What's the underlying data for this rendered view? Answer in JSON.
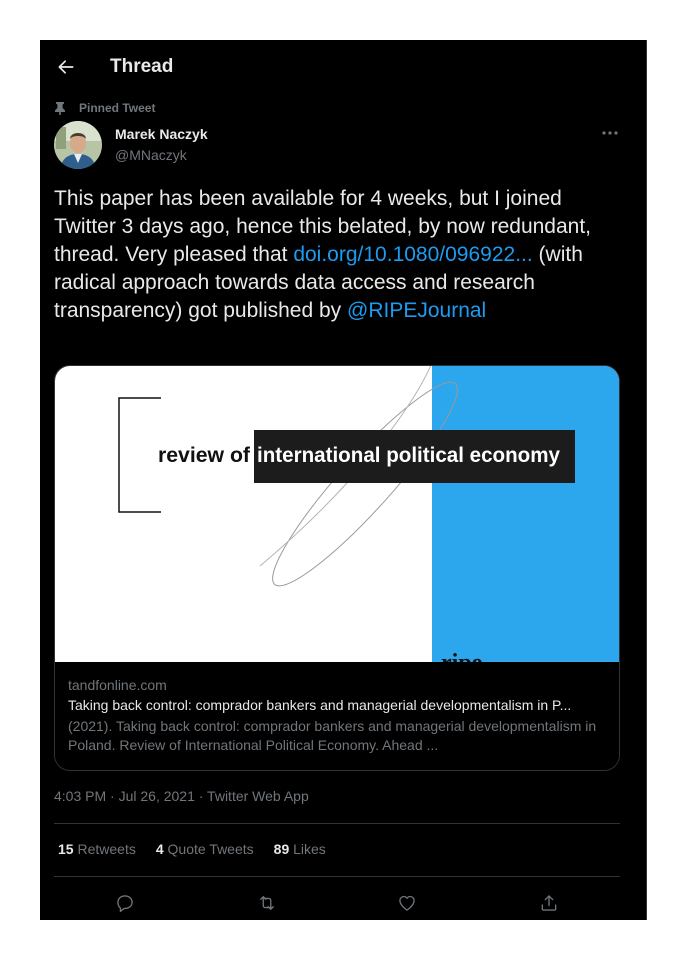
{
  "header": {
    "title": "Thread"
  },
  "pinned": {
    "label": "Pinned Tweet"
  },
  "author": {
    "name": "Marek Naczyk",
    "handle": "@MNaczyk"
  },
  "tweet": {
    "text_part1": "This paper has been available for 4 weeks, but I joined Twitter 3 days ago, hence this belated, by now redundant, thread. Very pleased that ",
    "link_doi": "doi.org/10.1080/096922...",
    "text_part2": " (with radical approach towards data access and research transparency) got published by ",
    "mention": "@RIPEJournal"
  },
  "card": {
    "image_text_prefix": "review of",
    "image_text_highlight": "international political economy",
    "image_text_logo": "ripe",
    "domain": "tandfonline.com",
    "title": "Taking back control: comprador bankers and managerial developmentalism in P...",
    "description": "(2021). Taking back control: comprador bankers and managerial developmentalism in Poland. Review of International Political Economy. Ahead ..."
  },
  "meta": {
    "timestamp": "4:03 PM · Jul 26, 2021 · Twitter Web App"
  },
  "stats": {
    "retweets_count": "15",
    "retweets_label": "Retweets",
    "quotes_count": "4",
    "quotes_label": "Quote Tweets",
    "likes_count": "89",
    "likes_label": "Likes"
  },
  "icons": {
    "back": "arrow-left-icon",
    "pin": "pin-icon",
    "more": "more-icon",
    "reply": "reply-icon",
    "retweet": "retweet-icon",
    "like": "heart-icon",
    "share": "share-icon"
  },
  "colors": {
    "background": "#000000",
    "text": "#e7e9ea",
    "secondary": "#71767b",
    "accent": "#1d9bf0",
    "border": "#2f3336",
    "card_blue": "#2ca6ec"
  }
}
